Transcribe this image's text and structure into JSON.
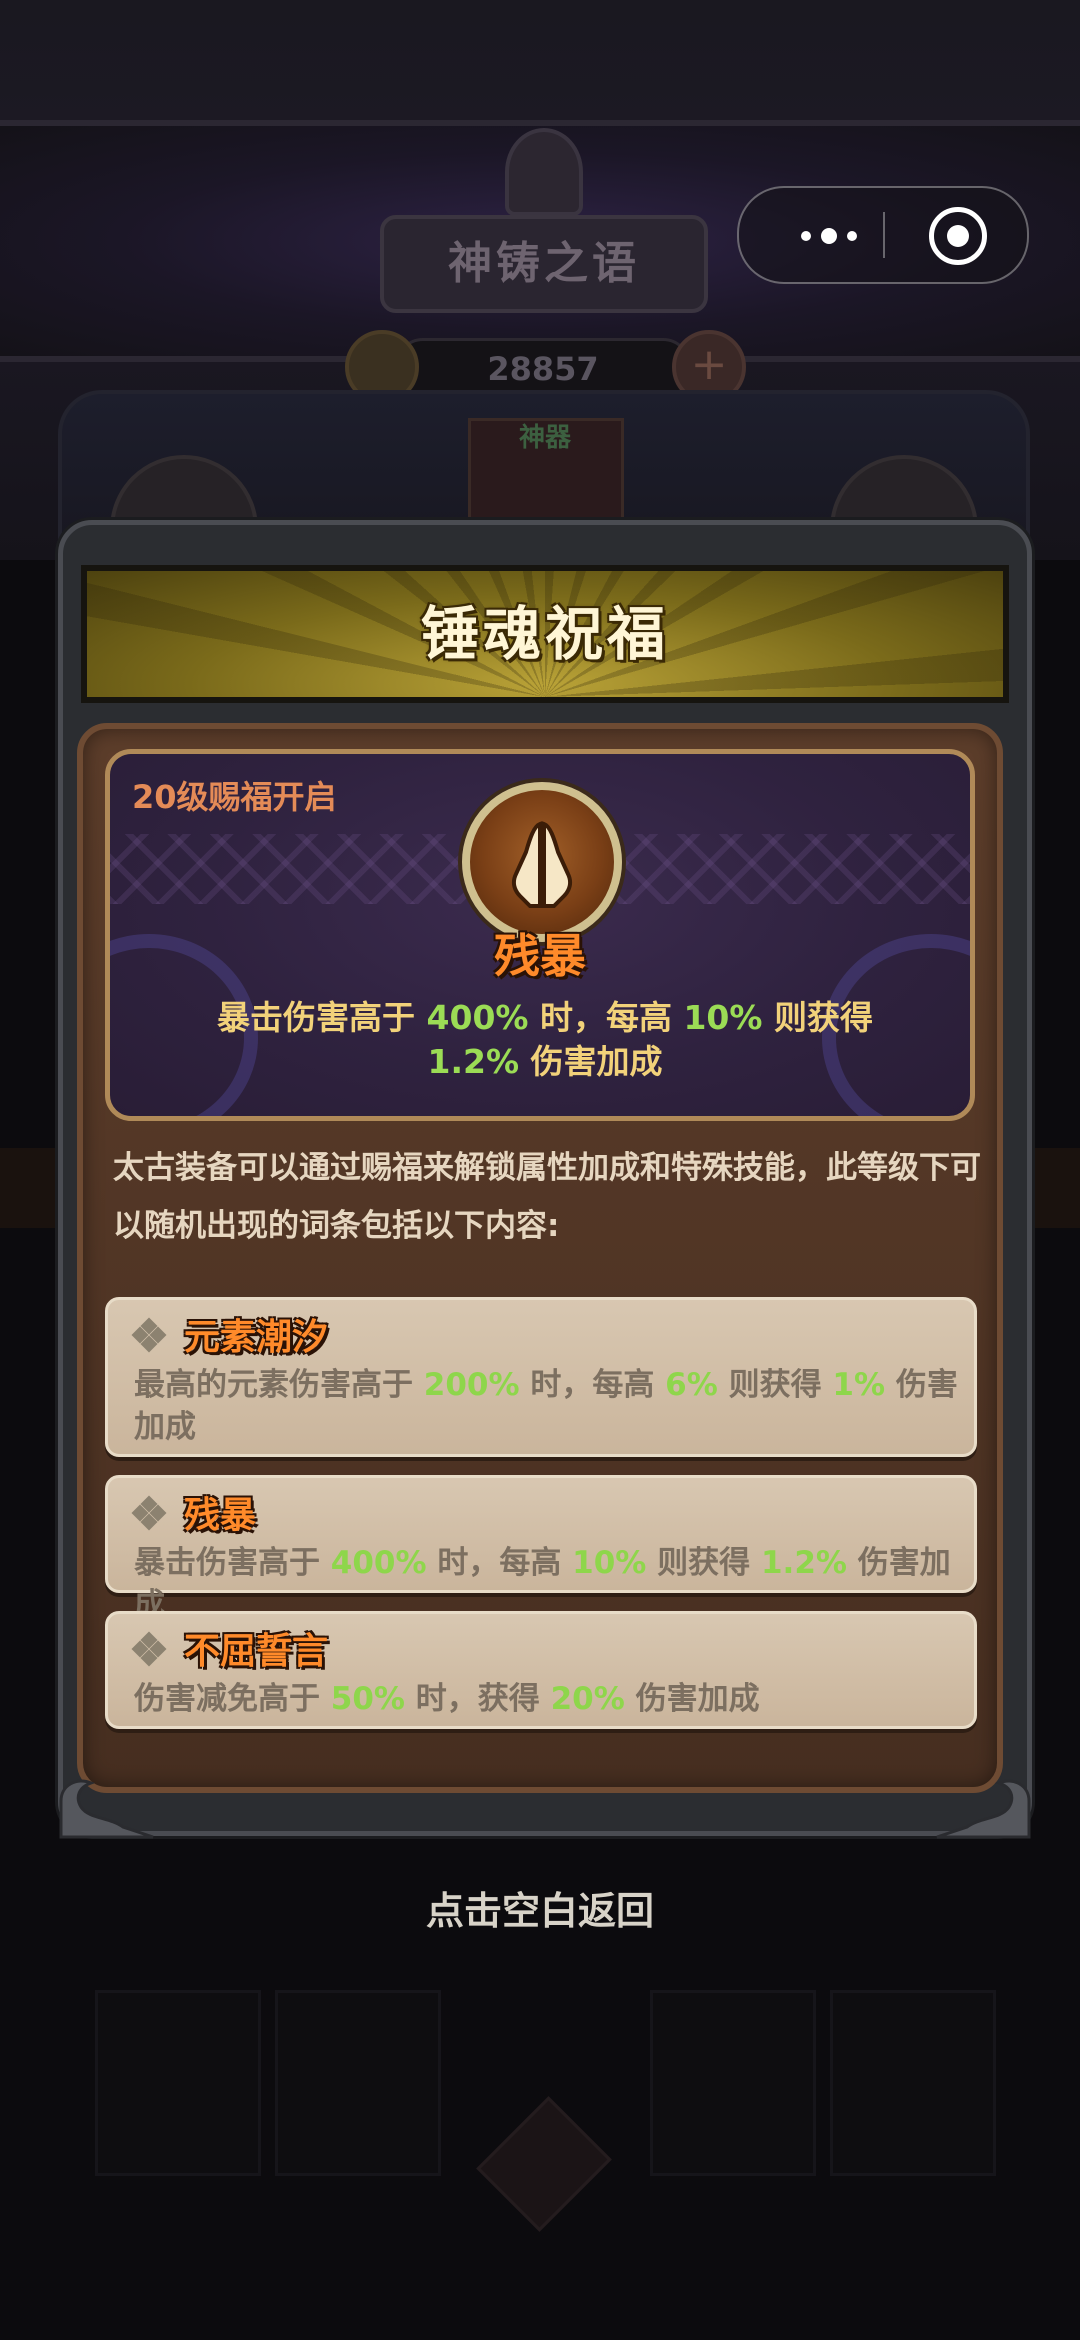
{
  "background": {
    "title": "神铸之语",
    "currency_amount": "28857",
    "locked_label": "神器"
  },
  "dialog": {
    "title": "锤魂祝福",
    "featured": {
      "unlock_label": "20级赐福开启",
      "name": "残暴",
      "desc_parts": [
        "暴击伤害高于 ",
        "400%",
        " 时，每高 ",
        "10%",
        " 则获得",
        "1.2%",
        " 伤害加成"
      ]
    },
    "intro": "太古装备可以通过赐福来解锁属性加成和特殊技能，此等级下可以随机出现的词条包括以下内容:",
    "entries": [
      {
        "name": "元素潮汐",
        "parts": [
          "最高的元素伤害高于 ",
          "200%",
          " 时，每高 ",
          "6%",
          " 则获得 ",
          "1%",
          " 伤害加成"
        ]
      },
      {
        "name": "残暴",
        "parts": [
          "暴击伤害高于 ",
          "400%",
          " 时，每高 ",
          "10%",
          " 则获得 ",
          "1.2%",
          " 伤害加成"
        ]
      },
      {
        "name": "不屈誓言",
        "parts": [
          "伤害减免高于 ",
          "50%",
          " 时，获得 ",
          "20%",
          " 伤害加成"
        ]
      }
    ]
  },
  "hint": "点击空白返回",
  "colors": {
    "highlight_green": "#9bdc55",
    "orange_title": "#ff8a2a",
    "gold_text": "#f2d27a"
  }
}
